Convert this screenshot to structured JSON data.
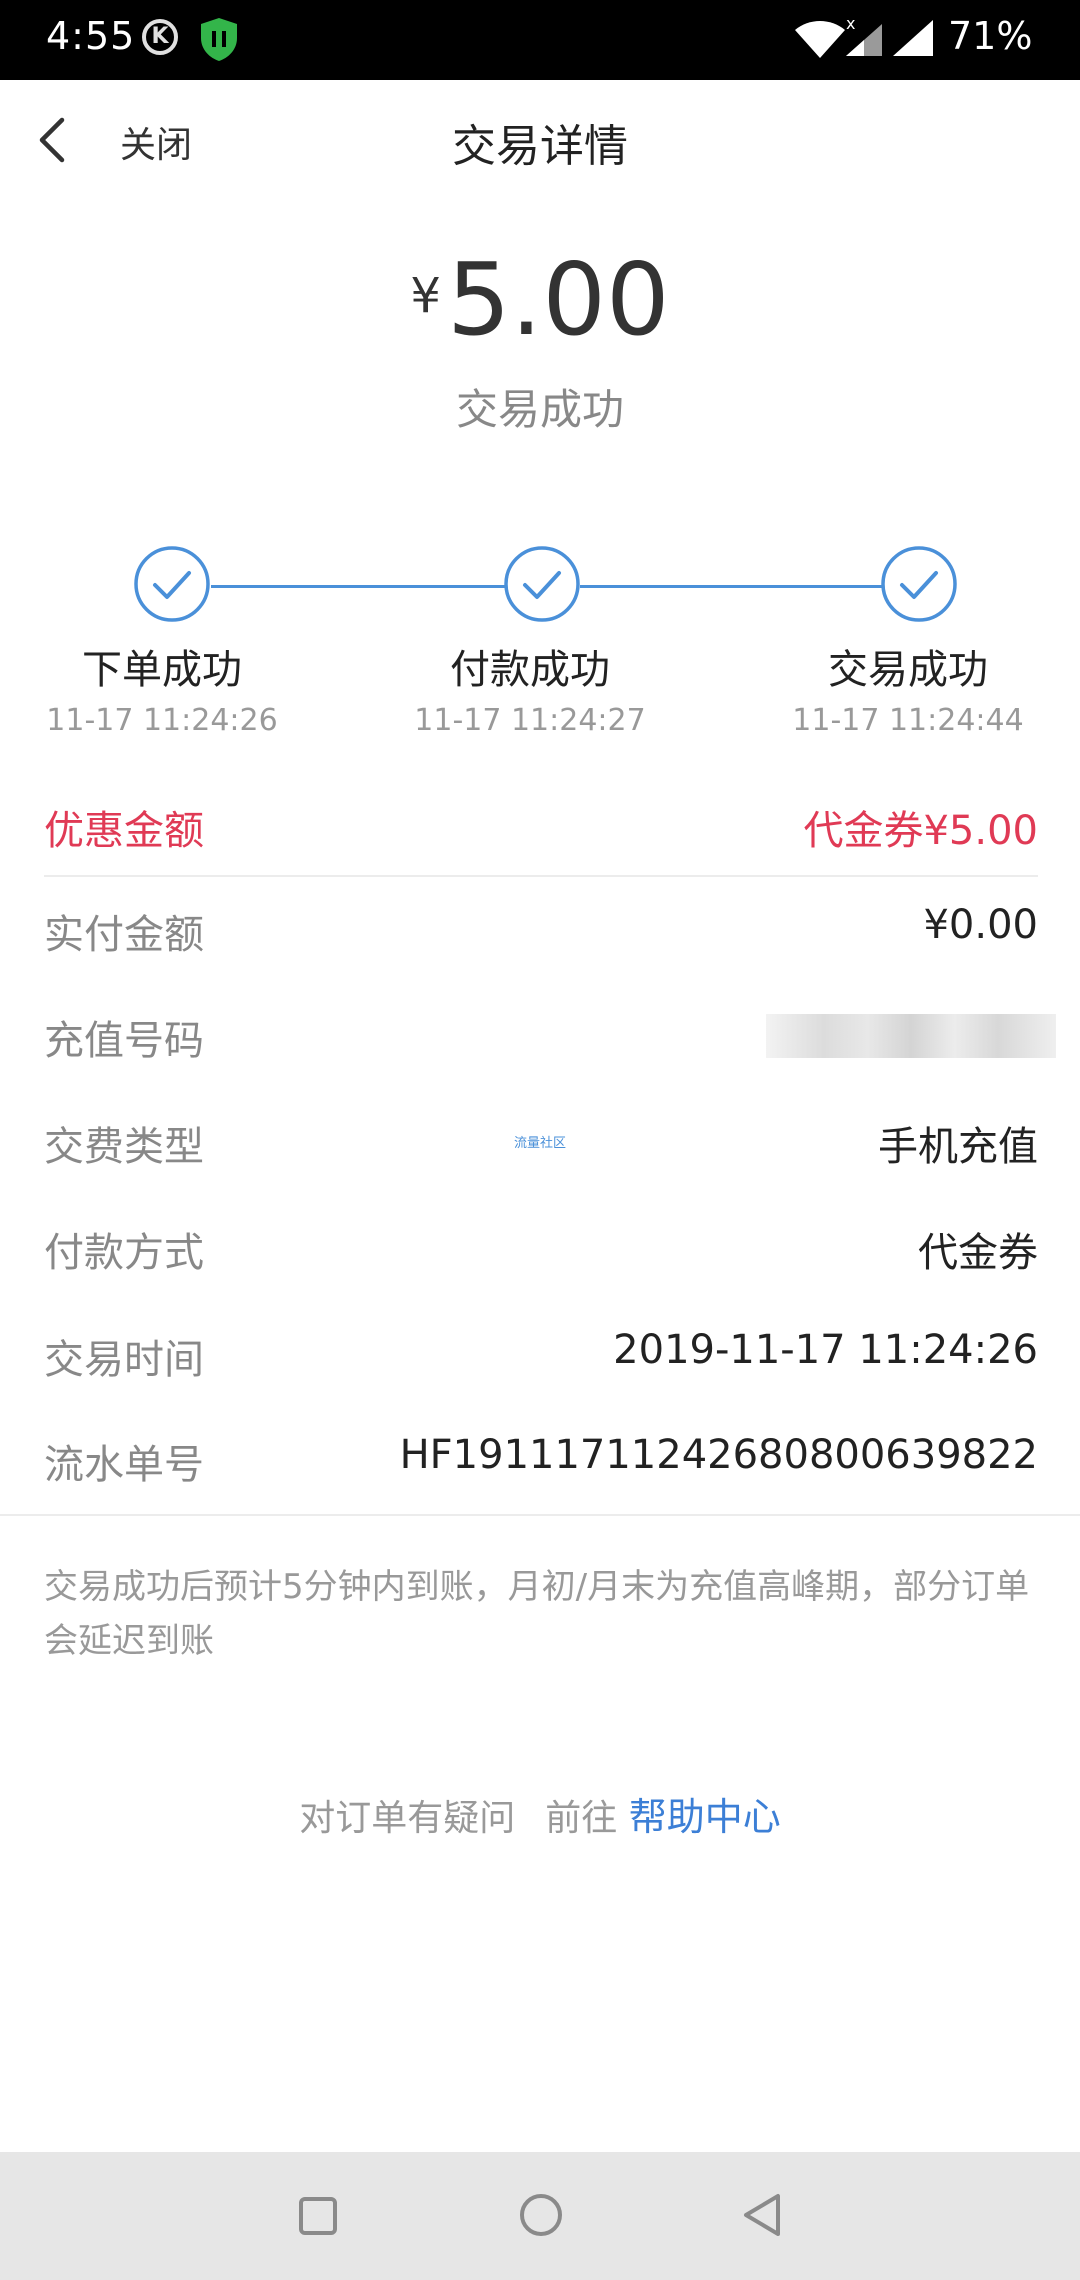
{
  "status_bar": {
    "time": "4:55",
    "k_badge": "K",
    "battery": "71%",
    "icons": [
      "k-circle-icon",
      "shield-icon",
      "wifi-icon",
      "signal-icon",
      "battery-text"
    ]
  },
  "header": {
    "close_label": "关闭",
    "title": "交易详情"
  },
  "summary": {
    "currency": "¥",
    "amount": "5.00",
    "status": "交易成功"
  },
  "steps": [
    {
      "label": "下单成功",
      "time": "11-17 11:24:26"
    },
    {
      "label": "付款成功",
      "time": "11-17 11:24:27"
    },
    {
      "label": "交易成功",
      "time": "11-17 11:24:44"
    }
  ],
  "details": {
    "discount": {
      "label": "优惠金额",
      "value": "代金券¥5.00"
    },
    "paid": {
      "label": "实付金额",
      "value": "¥0.00"
    },
    "phone": {
      "label": "充值号码",
      "value": ""
    },
    "fee_type": {
      "label": "交费类型",
      "value": "手机充值"
    },
    "pay_method": {
      "label": "付款方式",
      "value": "代金券"
    },
    "trade_time": {
      "label": "交易时间",
      "value": "2019-11-17 11:24:26"
    },
    "serial": {
      "label": "流水单号",
      "value": "HF19111711242680800639822"
    }
  },
  "watermark": "流量社区",
  "notice": "交易成功后预计5分钟内到账，月初/月末为充值高峰期，部分订单会延迟到账",
  "help": {
    "question": "对订单有疑问",
    "goto": "前往",
    "link": "帮助中心"
  },
  "colors": {
    "accent_red": "#e03a55",
    "link_blue": "#3c7fd6",
    "step_blue": "#4a90d9"
  }
}
